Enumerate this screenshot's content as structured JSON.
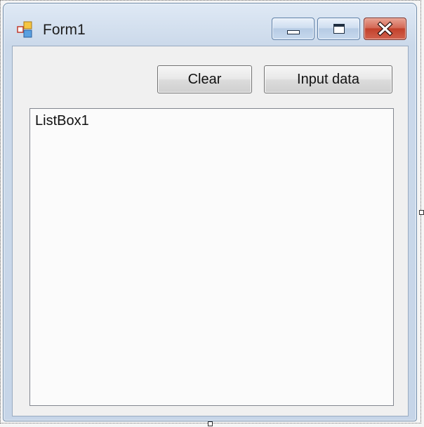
{
  "window": {
    "title": "Form1",
    "title_icon": "form-app-icon",
    "caption_buttons": [
      "minimize-icon",
      "maximize-icon",
      "close-icon"
    ]
  },
  "toolbar": {
    "clear_label": "Clear",
    "input_label": "Input data"
  },
  "listbox": {
    "items": [
      "ListBox1"
    ]
  },
  "colors": {
    "close_button": "#c2412b",
    "title_bar": "#cbd9ea",
    "client_area": "#f0f0f0"
  }
}
